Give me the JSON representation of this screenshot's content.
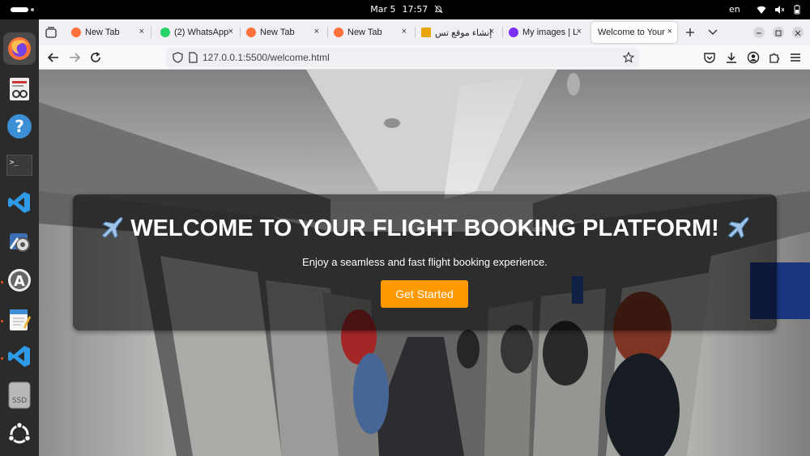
{
  "topbar": {
    "date": "Mar 5",
    "time": "17:57",
    "language": "en",
    "icons": [
      "activities-indicator",
      "do-not-disturb-icon",
      "wifi-icon",
      "volume-icon",
      "battery-icon"
    ]
  },
  "dock": {
    "apps": [
      {
        "name": "firefox-icon",
        "active": true
      },
      {
        "name": "document-viewer-icon",
        "active": false
      },
      {
        "name": "help-icon",
        "active": false
      },
      {
        "name": "terminal-icon",
        "active": false
      },
      {
        "name": "vscode-icon",
        "active": false
      },
      {
        "name": "settings-tool-icon",
        "active": false
      },
      {
        "name": "app-center-icon",
        "active": false
      },
      {
        "name": "text-editor-icon",
        "active": false
      },
      {
        "name": "vscode-icon",
        "active": false
      },
      {
        "name": "ssd-drive-icon",
        "active": false
      },
      {
        "name": "ubuntu-icon",
        "active": false
      }
    ],
    "ssd_label": "SSD"
  },
  "tabs": [
    {
      "label": "New Tab",
      "favicon": "firefox-icon"
    },
    {
      "label": "(2) WhatsApp",
      "favicon": "whatsapp-icon"
    },
    {
      "label": "New Tab",
      "favicon": "firefox-icon"
    },
    {
      "label": "New Tab",
      "favicon": "firefox-icon"
    },
    {
      "label": "إنشاء موقع تس",
      "favicon": "site-b-icon"
    },
    {
      "label": "My images | L",
      "favicon": "images-app-icon"
    },
    {
      "label": "Welcome to Your",
      "favicon": "",
      "active": true
    }
  ],
  "browser": {
    "url": "127.0.0.1:5500/welcome.html",
    "close_glyph": "×"
  },
  "page": {
    "title": "WELCOME TO YOUR FLIGHT BOOKING PLATFORM!",
    "subtitle": "Enjoy a seamless and fast flight booking experience.",
    "cta_label": "Get Started"
  },
  "colors": {
    "cta": "#ff9900",
    "card_overlay": "rgba(0,0,0,0.55)",
    "ubuntu_accent": "#e95420"
  }
}
